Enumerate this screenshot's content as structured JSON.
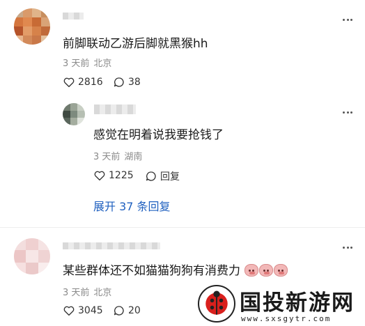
{
  "comments": [
    {
      "text": "前脚联动乙游后脚就黑猴hh",
      "time": "3 天前",
      "location": "北京",
      "likes": "2816",
      "replies": "38"
    }
  ],
  "reply": {
    "text": "感觉在明着说我要抢钱了",
    "time": "3 天前",
    "location": "湖南",
    "likes": "1225",
    "reply_label": "回复"
  },
  "expand_label": "展开 37 条回复",
  "comment2": {
    "text": "某些群体还不如猫猫狗狗有消费力",
    "time": "3 天前",
    "location": "北京",
    "likes": "3045",
    "replies": "20"
  },
  "watermark": {
    "title": "国投新游网",
    "url": "www.sxsgytr.com"
  },
  "icons": [
    "heart-icon",
    "comment-bubble-icon",
    "more-icon"
  ],
  "colors": {
    "link": "#1e5fbf",
    "meta": "#8a8a8a",
    "text": "#1a1a1a"
  }
}
